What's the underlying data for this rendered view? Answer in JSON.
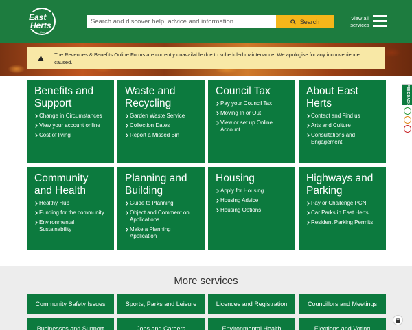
{
  "header": {
    "logo_text": "East Herts Council",
    "search_placeholder": "Search and discover help, advice and information",
    "search_button": "Search",
    "view_all_line1": "View all",
    "view_all_line2": "services"
  },
  "alert": {
    "text": "The Revenues & Benefits Online Forms are currently unavailable due to scheduled maintenance. We apologise for any inconvenience caused."
  },
  "tiles": [
    {
      "title_line1": "Benefits and",
      "title_line2": "Support",
      "links": [
        "Change in Circumstances",
        "View your account online",
        "Cost of living"
      ]
    },
    {
      "title_line1": "Waste and",
      "title_line2": "Recycling",
      "links": [
        "Garden Waste Service",
        "Collection Dates",
        "Report a Missed Bin"
      ]
    },
    {
      "title_line1": "Council Tax",
      "title_line2": "",
      "links": [
        "Pay your Council Tax",
        "Moving In or Out",
        "View or set up Online Account"
      ]
    },
    {
      "title_line1": "About East",
      "title_line2": "Herts",
      "links": [
        "Contact and Find us",
        "Arts and Culture",
        "Consultations and Engagement"
      ]
    },
    {
      "title_line1": "Community",
      "title_line2": "and Health",
      "links": [
        "Healthy Hub",
        "Funding for the community",
        "Environmental Sustainability"
      ]
    },
    {
      "title_line1": "Planning and",
      "title_line2": "Building",
      "links": [
        "Guide to Planning",
        "Object and Comment on Applications",
        "Make a Planning Application"
      ]
    },
    {
      "title_line1": "Housing",
      "title_line2": "",
      "links": [
        "Apply for Housing",
        "Housing Advice",
        "Housing Options"
      ]
    },
    {
      "title_line1": "Highways and",
      "title_line2": "Parking",
      "links": [
        "Pay or Challenge PCN",
        "Car Parks in East Herts",
        "Resident Parking Permits"
      ]
    }
  ],
  "more_services": {
    "title": "More services",
    "items": [
      "Community Safety Issues",
      "Sports, Parks and Leisure",
      "Licences and Registration",
      "Councillors and Meetings",
      "Businesses and Support",
      "Jobs and Careers",
      "Environmental Health",
      "Elections and Voting"
    ]
  },
  "feedback": {
    "label": "FEEDBACK"
  },
  "colors": {
    "header_green": "#1d7c3f",
    "tile_green": "#0c7a3e",
    "search_yellow": "#f5b61a",
    "alert_bg": "#f8e8a6"
  }
}
